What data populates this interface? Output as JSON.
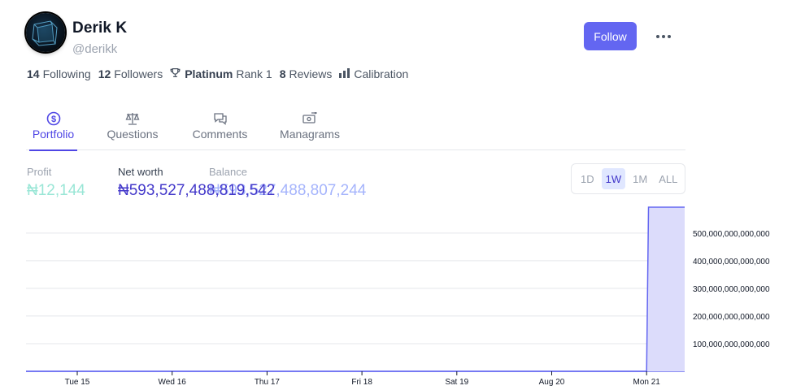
{
  "profile": {
    "name": "Derik K",
    "handle": "@derikk"
  },
  "actions": {
    "follow_label": "Follow"
  },
  "stats": {
    "following_count": "14",
    "following_label": "Following",
    "followers_count": "12",
    "followers_label": "Followers",
    "league_tier": "Platinum",
    "league_rank": "Rank 1",
    "reviews_count": "8",
    "reviews_label": "Reviews",
    "calibration_label": "Calibration"
  },
  "tabs": [
    {
      "label": "Portfolio",
      "icon": "dollar-circle-icon",
      "active": true
    },
    {
      "label": "Questions",
      "icon": "scale-icon",
      "active": false
    },
    {
      "label": "Comments",
      "icon": "chat-bubbles-icon",
      "active": false
    },
    {
      "label": "Managrams",
      "icon": "money-transfer-icon",
      "active": false
    }
  ],
  "metrics": {
    "profit_label": "Profit",
    "profit_value": "₦12,144",
    "networth_label": "Net worth",
    "networth_value": "₦593,527,488,819,542",
    "balance_label": "Balance",
    "balance_value": "₦593,527,488,807,244"
  },
  "time_range": {
    "options": [
      "1D",
      "1W",
      "1M",
      "ALL"
    ],
    "selected": "1W"
  },
  "colors": {
    "accent": "#6366f1",
    "active_tab": "#4f46e5",
    "area_fill": "#dcdcfb",
    "area_line": "#6366f1"
  },
  "chart_data": {
    "type": "area",
    "x_labels": [
      "Tue 15",
      "Wed 16",
      "Thu 17",
      "Fri 18",
      "Sat 19",
      "Aug 20",
      "Mon 21"
    ],
    "y_ticks": [
      "100,000,000,000,000",
      "200,000,000,000,000",
      "300,000,000,000,000",
      "400,000,000,000,000",
      "500,000,000,000,000"
    ],
    "ylim": [
      0,
      593527488819542
    ],
    "grid": true,
    "points": [
      {
        "x": 0,
        "y": 0
      },
      {
        "x": 6.0,
        "y": 0
      },
      {
        "x": 6.02,
        "y": 593527488819542
      },
      {
        "x": 6.45,
        "y": 593527488819542
      }
    ]
  }
}
